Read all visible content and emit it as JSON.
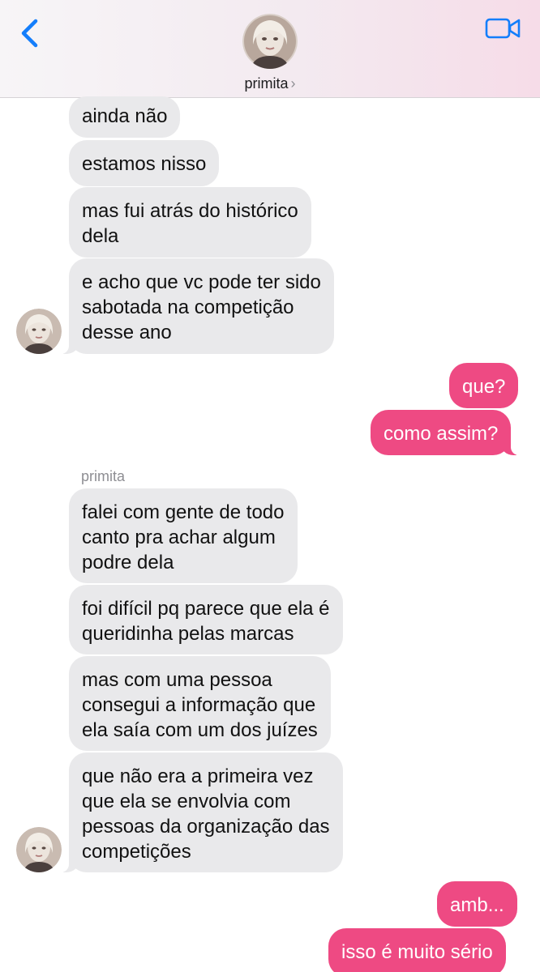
{
  "header": {
    "contact_name": "primita",
    "chevron": "›",
    "back_icon": "chevron-left-icon",
    "video_icon": "video-camera-icon",
    "accent_color": "#147efb"
  },
  "colors": {
    "incoming_bubble": "#e9e9eb",
    "outgoing_bubble": "#ee4a83"
  },
  "sender_label": "primita",
  "messages": [
    {
      "from": "primita",
      "text": "ainda não"
    },
    {
      "from": "primita",
      "text": "estamos nisso"
    },
    {
      "from": "primita",
      "text": "mas fui atrás do histórico\ndela"
    },
    {
      "from": "primita",
      "text": "e acho que vc pode ter sido\nsabotada na competição\ndesse ano"
    },
    {
      "from": "me",
      "text": "que?"
    },
    {
      "from": "me",
      "text": "como assim?"
    },
    {
      "from": "primita",
      "text": "falei com gente de todo\ncanto pra achar algum\npodre dela"
    },
    {
      "from": "primita",
      "text": "foi difícil pq parece que ela é\nqueridinha pelas marcas"
    },
    {
      "from": "primita",
      "text": "mas com uma pessoa\nconsegui a informação que\nela saía com um dos juízes"
    },
    {
      "from": "primita",
      "text": "que não era a primeira vez\nque ela se envolvia com\npessoas da organização das\ncompetições"
    },
    {
      "from": "me",
      "text": "amb..."
    },
    {
      "from": "me",
      "text": "isso é muito sério"
    }
  ]
}
